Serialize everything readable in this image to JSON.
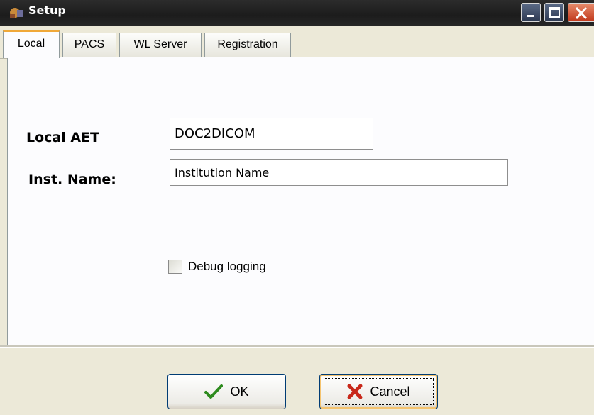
{
  "window": {
    "title": "Setup",
    "icon": "app-icon",
    "controls": [
      "minimize-icon",
      "maximize-icon",
      "close-icon"
    ]
  },
  "tabs": [
    {
      "label": "Local",
      "active": true
    },
    {
      "label": "PACS",
      "active": false
    },
    {
      "label": "WL Server",
      "active": false
    },
    {
      "label": "Registration",
      "active": false
    }
  ],
  "form": {
    "local_aet_label": "Local AET",
    "local_aet_value": "DOC2DICOM",
    "inst_name_label": "Inst. Name:",
    "inst_name_value": "Institution Name",
    "debug_logging_label": "Debug logging",
    "debug_logging_checked": false
  },
  "buttons": {
    "ok_label": "OK",
    "ok_icon": "checkmark-icon",
    "cancel_label": "Cancel",
    "cancel_icon": "x-mark-icon"
  },
  "colors": {
    "titlebar": "#1c1c1c",
    "active_tab_accent": "#f0a838",
    "ok_icon": "#2e8b1e",
    "cancel_icon": "#c8281a"
  }
}
